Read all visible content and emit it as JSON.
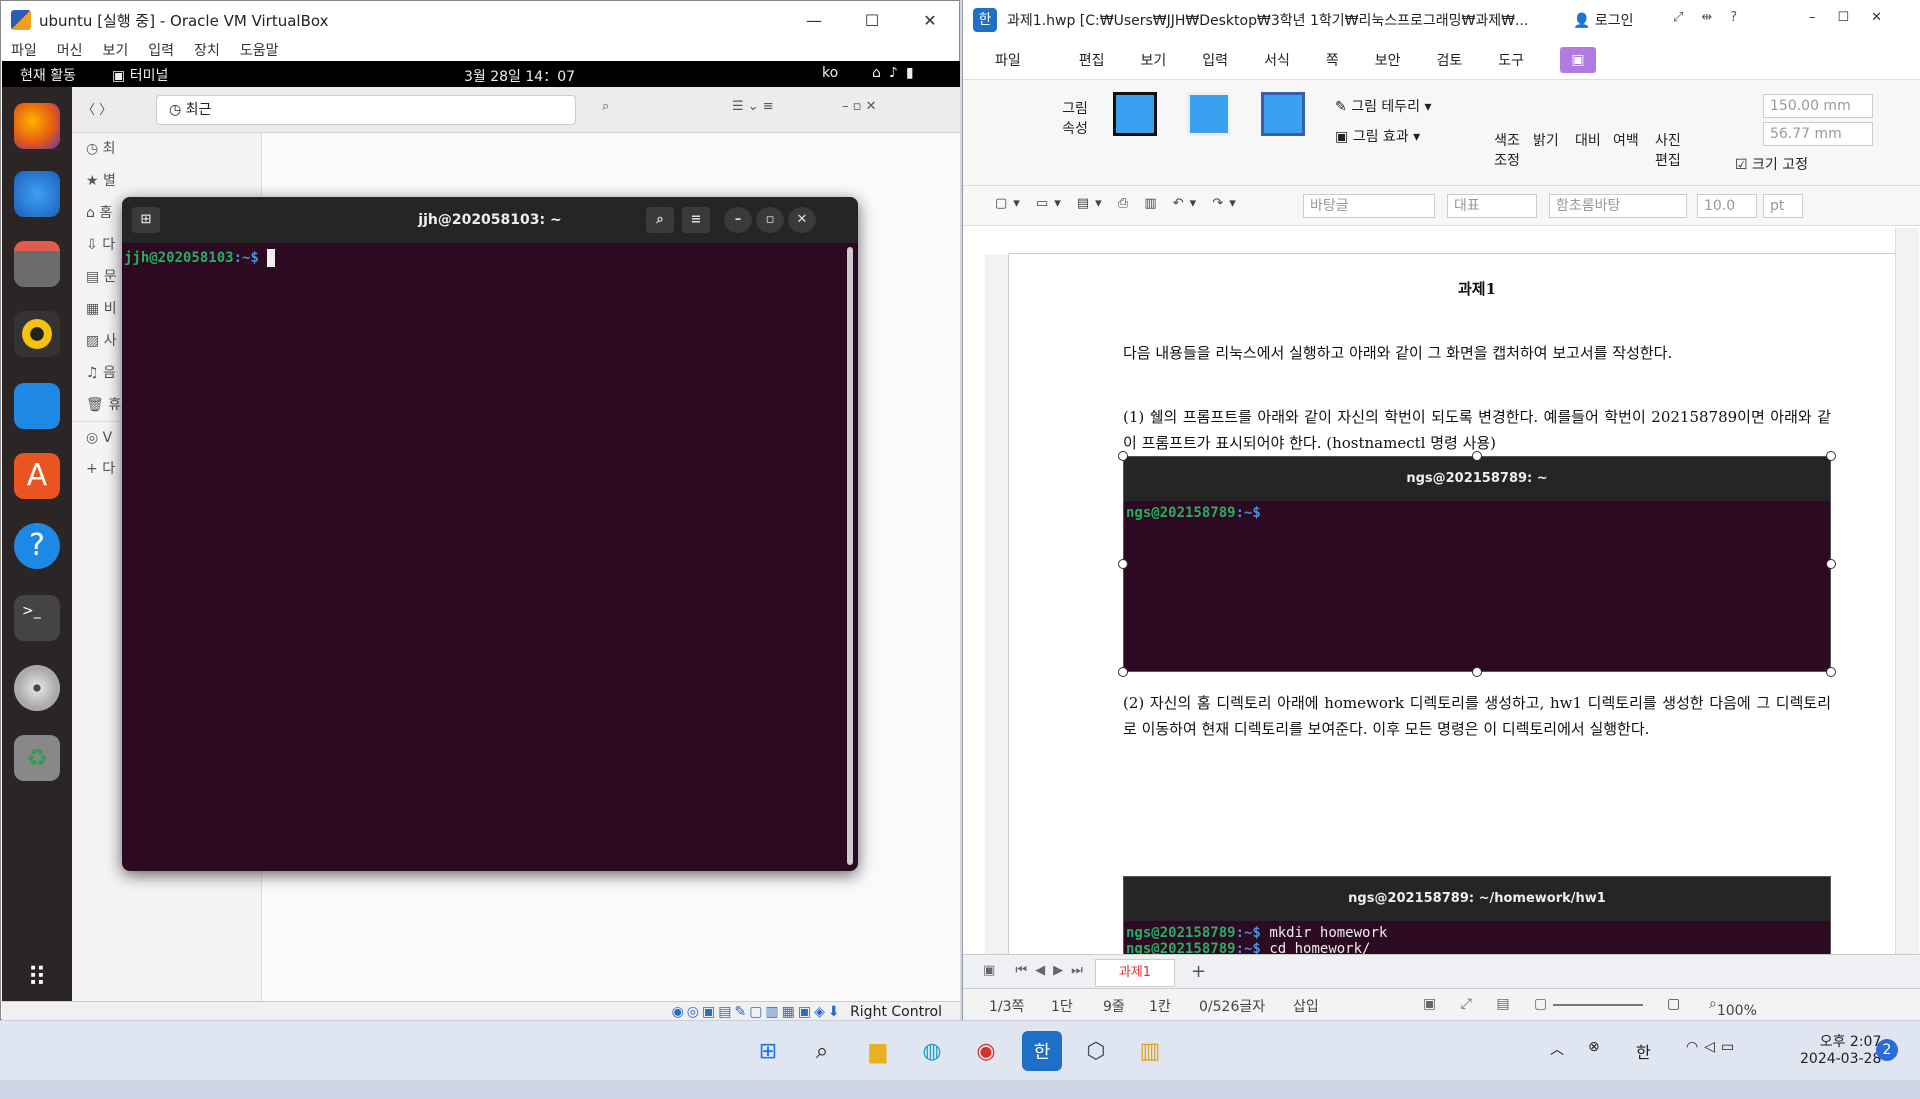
{
  "vbox": {
    "title": "ubuntu [실행 중] - Oracle VM VirtualBox",
    "menu": [
      "파일",
      "머신",
      "보기",
      "입력",
      "장치",
      "도움말"
    ],
    "status_key": "Right Control"
  },
  "ubuntu": {
    "activities": "현재 활동",
    "app_name": "터미널",
    "clock": "3월 28일  14：07",
    "lang": "ko",
    "files": {
      "path": "최근",
      "sidebar": [
        "최",
        "별",
        "홈",
        "다",
        "문",
        "비",
        "사",
        "음",
        "휴",
        "V",
        "다"
      ]
    },
    "terminal": {
      "title": "jjh@202058103: ~",
      "prompt_user": "jjh@202058103",
      "prompt_path": ":~$"
    }
  },
  "hwp": {
    "title": "과제1.hwp [C:₩Users₩JJH₩Desktop₩3학년 1학기₩리눅스프로그래밍₩과제₩...",
    "login": "로그인",
    "menu": [
      "파일",
      "편집",
      "보기",
      "입력",
      "서식",
      "쪽",
      "보안",
      "검토",
      "도구"
    ],
    "ribbon": {
      "pic_props": "그림\n속성",
      "border": "그림 테두리",
      "effect": "그림 효과",
      "color_adjust": "색조\n조정",
      "brightness": "밝기",
      "contrast": "대비",
      "margin": "여백",
      "photo_edit": "사진\n편집",
      "width": "150.00 mm",
      "height": "56.77 mm",
      "fix_size": "크기 고정"
    },
    "toolbar": {
      "style": "바탕글",
      "rep": "대표",
      "font": "함초롬바탕",
      "size": "10.0",
      "unit": "pt"
    },
    "doc": {
      "title": "과제1",
      "para1": "다음 내용들을 리눅스에서 실행하고 아래와 같이 그 화면을 캡처하여 보고서를 작성한다.",
      "para2": "(1) 쉘의 프롬프트를 아래와 같이 자신의 학번이 되도록 변경한다. 예를들어 학번이 202158789이면 아래와 같이 프롬프트가 표시되어야 한다. (hostnamectl 명령 사용)",
      "shot1_title": "ngs@202158789: ~",
      "shot1_user": "ngs@202158789",
      "shot1_path": ":~$",
      "para3": "(2) 자신의 홈 디렉토리 아래에 homework 디렉토리를 생성하고, hw1 디렉토리를 생성한 다음에 그 디렉토리로 이동하여 현재 디렉토리를 보여준다. 이후 모든 명령은 이 디렉토리에서 실행한다.",
      "shot2_title": "ngs@202158789: ~/homework/hw1",
      "shot2_line1_cmd": "mkdir homework",
      "shot2_line2_cmd": "cd homework/"
    },
    "tab_name": "과제1",
    "status": {
      "page": "1/3쪽",
      "col": "1단",
      "line": "9줄",
      "pos": "1칸",
      "chars": "0/526글자",
      "mode": "삽입",
      "zoom": "100%"
    }
  },
  "taskbar": {
    "ime": "한",
    "time": "오후 2:07",
    "date": "2024-03-28",
    "notif_count": "2"
  }
}
